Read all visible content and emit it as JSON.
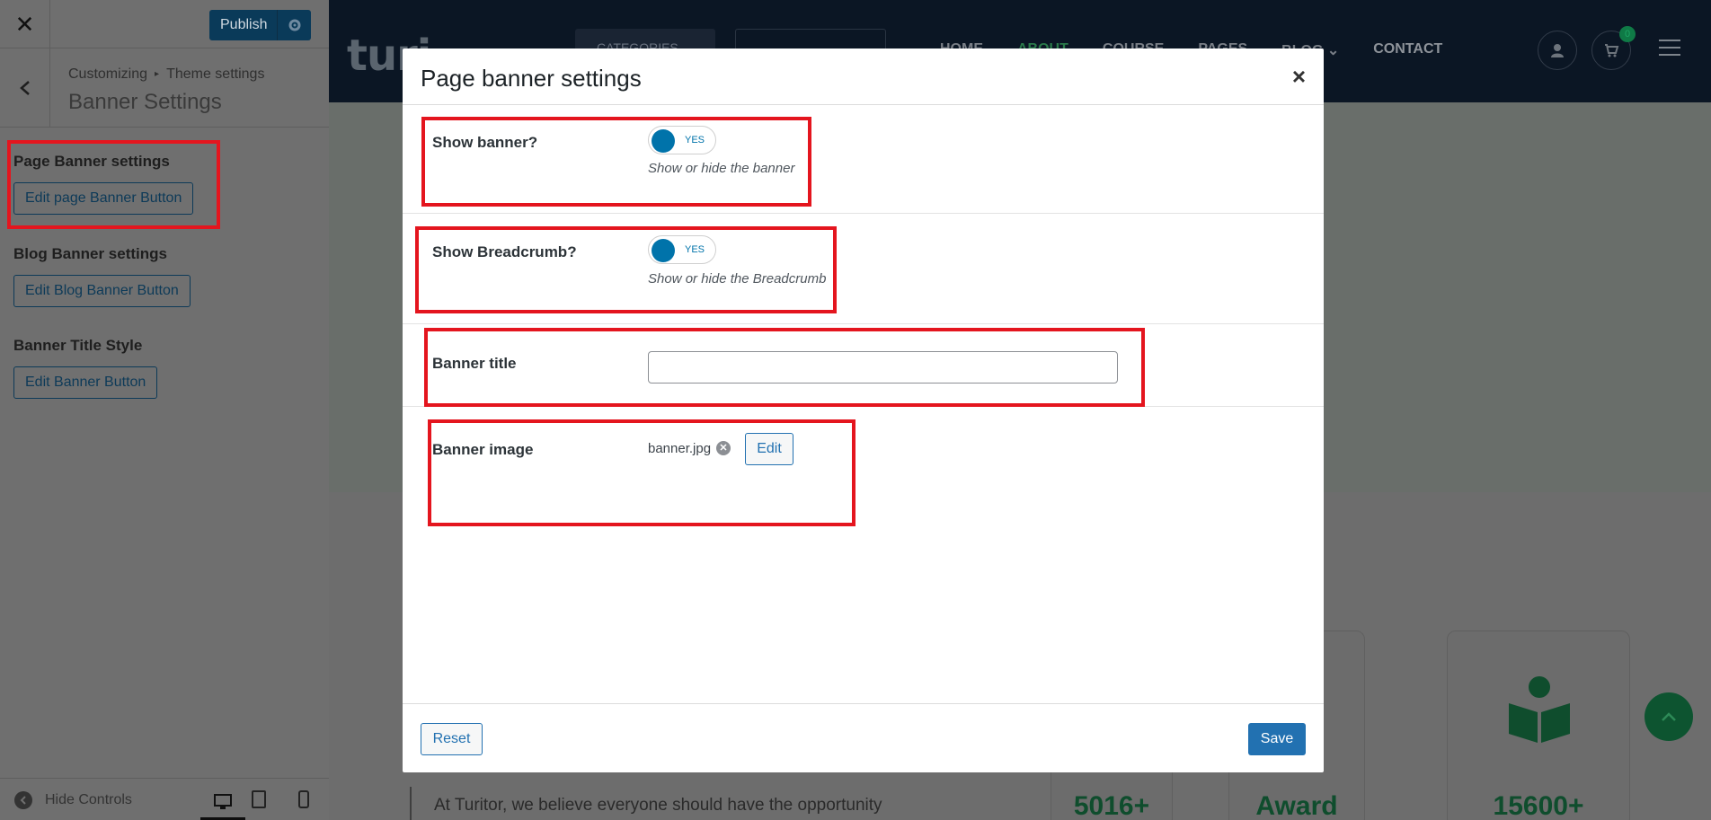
{
  "customizer": {
    "publish_label": "Publish",
    "breadcrumb_root": "Customizing",
    "breadcrumb_sep": "▸",
    "breadcrumb_parent": "Theme settings",
    "section_title": "Banner Settings",
    "groups": [
      {
        "title": "Page Banner settings",
        "button": "Edit page Banner Button"
      },
      {
        "title": "Blog Banner settings",
        "button": "Edit Blog Banner Button"
      },
      {
        "title": "Banner Title Style",
        "button": "Edit Banner Button"
      }
    ],
    "hide_controls_label": "Hide Controls"
  },
  "site": {
    "logo_text": "turi",
    "categories_label": "CATEGORIES",
    "nav": [
      "HOME",
      "ABOUT",
      "COURSE",
      "PAGES",
      "BLOG ⌄",
      "CONTACT"
    ],
    "cart_count": "0",
    "stats": [
      "5016+",
      "Award",
      "15600+"
    ],
    "about_text": "At Turitor, we believe everyone should have the opportunity"
  },
  "modal": {
    "title": "Page banner settings",
    "close_symbol": "×",
    "show_banner_label": "Show banner?",
    "show_banner_value": "YES",
    "show_banner_hint": "Show or hide the banner",
    "show_breadcrumb_label": "Show Breadcrumb?",
    "show_breadcrumb_value": "YES",
    "show_breadcrumb_hint": "Show or hide the Breadcrumb",
    "banner_title_label": "Banner title",
    "banner_title_value": "",
    "banner_image_label": "Banner image",
    "banner_image_file": "banner.jpg",
    "edit_label": "Edit",
    "reset_label": "Reset",
    "save_label": "Save"
  },
  "colors": {
    "accent": "#2271b1",
    "toggle_on": "#0073aa",
    "highlight": "#e4151e",
    "site_green": "#0f7a46"
  }
}
